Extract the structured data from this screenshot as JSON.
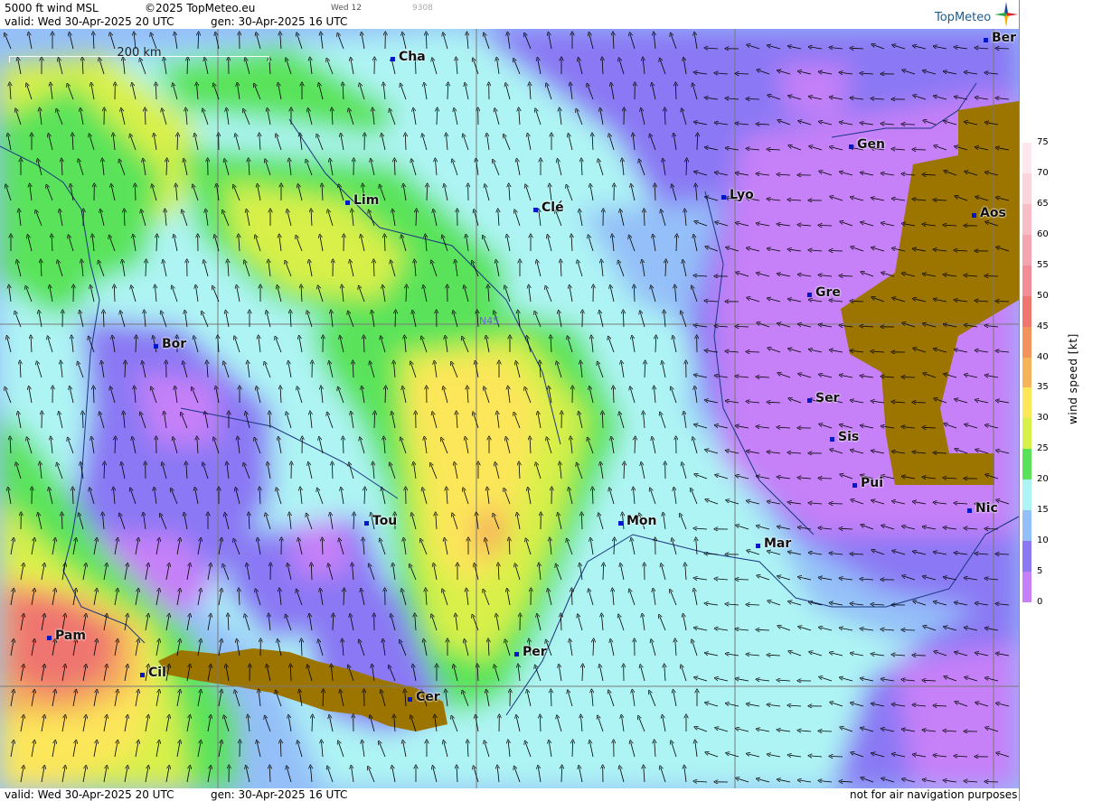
{
  "header": {
    "product": "5000 ft wind MSL",
    "copyright": "©2025 TopMeteo.eu",
    "small_day": "Wed 12",
    "small_code": "9308",
    "valid": "valid:  Wed  30-Apr-2025  20 UTC",
    "gen": "gen: 30-Apr-2025 16 UTC"
  },
  "logo": {
    "text": "TopMeteo",
    "icon": "compass-star-icon"
  },
  "scale": {
    "label": "200 km"
  },
  "gridlabel": "N45",
  "cities": [
    {
      "name": "Cha"
    },
    {
      "name": "Ber"
    },
    {
      "name": "Gen"
    },
    {
      "name": "Lim"
    },
    {
      "name": "Clé"
    },
    {
      "name": "Lyo"
    },
    {
      "name": "Aos"
    },
    {
      "name": "Gre"
    },
    {
      "name": "Bor"
    },
    {
      "name": "Ser"
    },
    {
      "name": "Sis"
    },
    {
      "name": "Pui"
    },
    {
      "name": "Tou"
    },
    {
      "name": "Mon"
    },
    {
      "name": "Nic"
    },
    {
      "name": "Mar"
    },
    {
      "name": "Pam"
    },
    {
      "name": "Cil"
    },
    {
      "name": "Per"
    },
    {
      "name": "Cer"
    }
  ],
  "legend": {
    "unit": "wind speed [kt]",
    "ticks": [
      "75",
      "70",
      "65",
      "60",
      "55",
      "50",
      "45",
      "40",
      "35",
      "30",
      "25",
      "20",
      "15",
      "10",
      "5",
      "0"
    ],
    "colors": [
      "#ffffff",
      "#fce8ec",
      "#fbd3da",
      "#f8bcc6",
      "#f5a5b0",
      "#f28c96",
      "#ef7670",
      "#f2935c",
      "#f5b35a",
      "#fce65a",
      "#d8f04a",
      "#5ae35a",
      "#aef4f4",
      "#94c0f8",
      "#8a78f4",
      "#c680f8"
    ]
  },
  "footer": {
    "valid": "valid:  Wed  30-Apr-2025  20 UTC",
    "gen": "gen: 30-Apr-2025 16 UTC",
    "disclaimer": "not for air navigation purposes"
  }
}
